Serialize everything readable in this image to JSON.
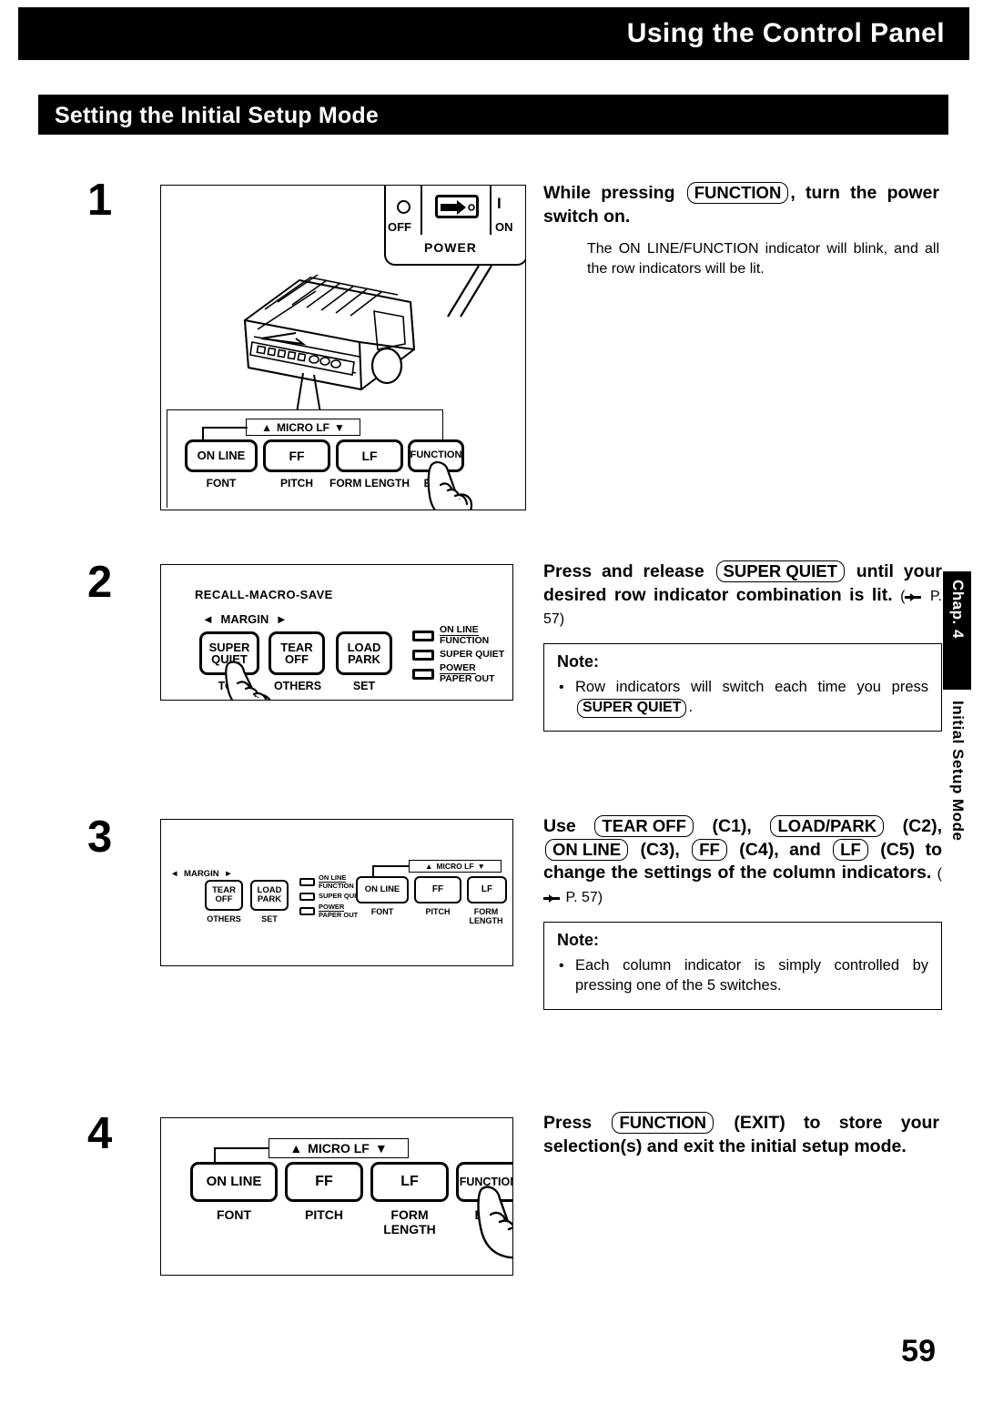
{
  "header": {
    "chapter_title": "Using the Control Panel",
    "section_title": "Setting the Initial Setup Mode"
  },
  "side_tab": {
    "chapter": "Chap. 4",
    "label": "Initial Setup Mode"
  },
  "page_number": "59",
  "steps": [
    {
      "number": "1",
      "lead_before": "While pressing",
      "key1": "FUNCTION",
      "lead_after": ", turn the power switch on.",
      "sub": "The ON LINE/FUNCTION indicator will blink, and all the row indicators will be lit.",
      "figure": {
        "power_label": "POWER",
        "off_label": "OFF",
        "on_label": "ON",
        "off_symbol": "O",
        "on_symbol": "I",
        "micro_lf": "MICRO LF",
        "up_arrow": "▲",
        "down_arrow": "▼",
        "buttons": [
          {
            "name": "ON LINE",
            "sub": "FONT"
          },
          {
            "name": "FF",
            "sub": "PITCH"
          },
          {
            "name": "LF",
            "sub": "FORM LENGTH"
          },
          {
            "name": "FUNCTION",
            "sub": "EXIT"
          }
        ]
      }
    },
    {
      "number": "2",
      "lead_before": "Press and release",
      "key1": "SUPER QUIET",
      "lead_after": "until your desired row indicator combination is lit.",
      "ref": "P. 57",
      "note_title": "Note:",
      "note_before": "Row indicators will switch each time you press",
      "note_key": "SUPER QUIET",
      "note_after": ".",
      "figure": {
        "recall_macro_save": "RECALL-MACRO-SAVE",
        "margin": "MARGIN",
        "left_arrow": "◄",
        "right_arrow": "►",
        "buttons": [
          {
            "name": "SUPER\nQUIET",
            "sub": "TOF"
          },
          {
            "name": "TEAR\nOFF",
            "sub": "OTHERS"
          },
          {
            "name": "LOAD\nPARK",
            "sub": "SET"
          }
        ],
        "indicators": [
          {
            "top": "ON LINE",
            "bottom": "FUNCTION"
          },
          {
            "top": "",
            "bottom": "SUPER QUIET"
          },
          {
            "top": "POWER",
            "bottom": "PAPER OUT"
          }
        ]
      }
    },
    {
      "number": "3",
      "lead_use": "Use",
      "keys": [
        {
          "key": "TEAR OFF",
          "col": "(C1),"
        },
        {
          "key": "LOAD/PARK",
          "col": "(C2),"
        },
        {
          "key": "ON LINE",
          "col": "(C3),"
        },
        {
          "key": "FF",
          "col": "(C4), and"
        },
        {
          "key": "LF",
          "col": "(C5) to change the settings of the column indicators."
        }
      ],
      "ref": "P. 57",
      "note_title": "Note:",
      "note_text": "Each column indicator is simply controlled by pressing one of the 5 switches.",
      "figure": {
        "margin": "MARGIN",
        "left_arrow": "◄",
        "right_arrow": "►",
        "micro_lf": "MICRO LF",
        "up_arrow": "▲",
        "down_arrow": "▼",
        "buttons_left": [
          {
            "name": "TEAR\nOFF",
            "sub": "OTHERS"
          },
          {
            "name": "LOAD\nPARK",
            "sub": "SET"
          }
        ],
        "indicators": [
          {
            "top": "ON LINE",
            "bottom": "FUNCTION"
          },
          {
            "top": "",
            "bottom": "SUPER QUIET"
          },
          {
            "top": "POWER",
            "bottom": "PAPER OUT"
          }
        ],
        "buttons_right": [
          {
            "name": "ON LINE",
            "sub": "FONT"
          },
          {
            "name": "FF",
            "sub": "PITCH"
          },
          {
            "name": "LF",
            "sub": "FORM LENGTH"
          }
        ]
      }
    },
    {
      "number": "4",
      "lead_before": "Press",
      "key1": "FUNCTION",
      "lead_after": "(EXIT) to store your selection(s) and exit the initial setup mode.",
      "figure": {
        "micro_lf": "MICRO LF",
        "up_arrow": "▲",
        "down_arrow": "▼",
        "buttons": [
          {
            "name": "ON LINE",
            "sub": "FONT"
          },
          {
            "name": "FF",
            "sub": "PITCH"
          },
          {
            "name": "LF",
            "sub": "FORM LENGTH"
          },
          {
            "name": "FUNCTION",
            "sub": "EXIT"
          }
        ]
      }
    }
  ]
}
